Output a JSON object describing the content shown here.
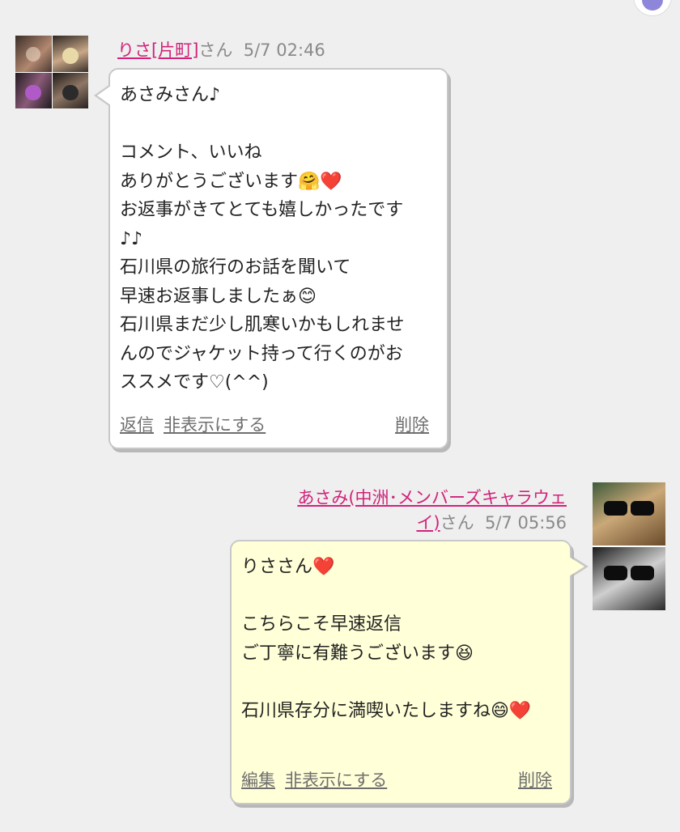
{
  "received": {
    "sender_name": "りさ[片町]",
    "sender_suffix": "さん",
    "timestamp": "5/7 02:46",
    "lines": [
      "あさみさん♪",
      "",
      "コメント、いいね",
      "ありがとうございます🤗❤️",
      "お返事がきてとても嬉しかったです",
      "♪♪",
      "石川県の旅行のお話を聞いて",
      "早速お返事しましたぁ😊",
      "石川県まだ少し肌寒いかもしれませ",
      "んのでジャケット持って行くのがお",
      "ススメです♡(^^)"
    ],
    "actions": {
      "reply": "返信",
      "hide": "非表示にする",
      "delete": "削除"
    }
  },
  "sent": {
    "sender_name_line1": "あさみ(中洲･メンバーズキャラウェ",
    "sender_name_line2": "イ)",
    "sender_suffix": "さん",
    "timestamp": "5/7 05:56",
    "lines": [
      "りささん❤️",
      "",
      "こちらこそ早速返信",
      "ご丁寧に有難うございます😆",
      "",
      "石川県存分に満喫いたしますね😄❤️"
    ],
    "actions": {
      "edit": "編集",
      "hide": "非表示にする",
      "delete": "削除"
    }
  },
  "icons": {
    "fab": "chat-bubble-icon"
  },
  "colors": {
    "background": "#efefef",
    "name_link": "#d1237a",
    "sent_bubble": "#ffffd8",
    "received_bubble": "#ffffff",
    "fab_accent": "#8e86d8"
  }
}
